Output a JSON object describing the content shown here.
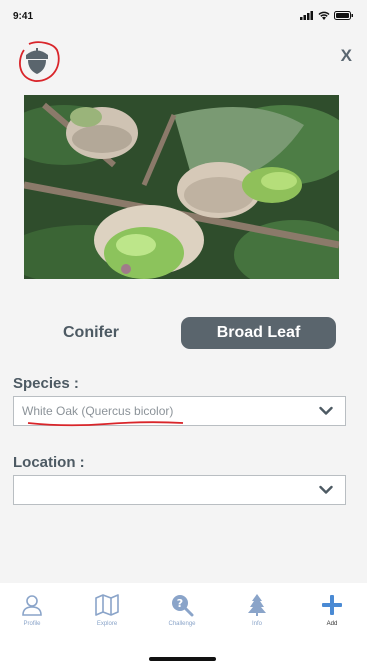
{
  "status": {
    "time": "9:41"
  },
  "header": {
    "close_label": "X"
  },
  "toggle": {
    "conifer_label": "Conifer",
    "broadleaf_label": "Broad Leaf",
    "selected": "broadleaf"
  },
  "species": {
    "label": "Species :",
    "value": "White Oak (Quercus bicolor)"
  },
  "location": {
    "label": "Location :",
    "value": ""
  },
  "tabs": [
    {
      "label": "Profile",
      "icon": "person-icon"
    },
    {
      "label": "Explore",
      "icon": "map-icon"
    },
    {
      "label": "Challenge",
      "icon": "question-search-icon"
    },
    {
      "label": "Info",
      "icon": "tree-icon"
    },
    {
      "label": "Add",
      "icon": "plus-icon"
    }
  ],
  "colors": {
    "accent": "#4a8ad4",
    "toggle_active": "#5a656d",
    "annotation": "#d9252a"
  }
}
